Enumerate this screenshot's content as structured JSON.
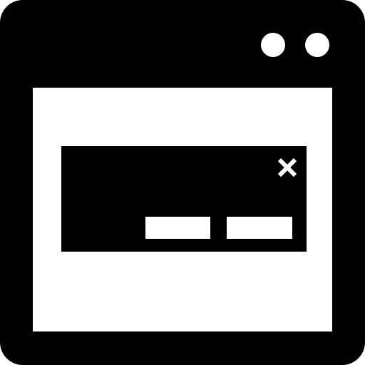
{
  "colors": {
    "frame": "#000000",
    "content": "#ffffff",
    "dialog": "#000000",
    "dialog_controls": "#ffffff"
  },
  "icons": {
    "window_controls": [
      "circle-dot-icon",
      "circle-dot-icon"
    ],
    "dialog_close": "close-icon"
  }
}
